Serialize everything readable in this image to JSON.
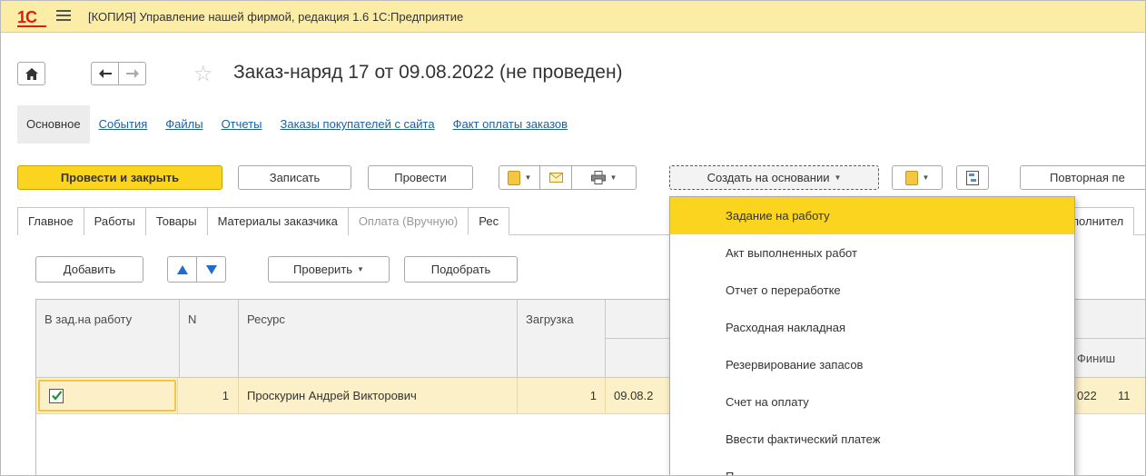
{
  "window": {
    "title": "[КОПИЯ] Управление нашей фирмой, редакция 1.6 1С:Предприятие",
    "logo_text": "1С"
  },
  "document": {
    "title": "Заказ-наряд 17 от 09.08.2022 (не проведен)"
  },
  "sections": [
    {
      "label": "Основное",
      "active": true
    },
    {
      "label": "События"
    },
    {
      "label": "Файлы"
    },
    {
      "label": "Отчеты"
    },
    {
      "label": "Заказы покупателей с сайта"
    },
    {
      "label": "Факт оплаты заказов"
    }
  ],
  "commands": {
    "post_close": "Провести и закрыть",
    "record": "Записать",
    "post": "Провести",
    "create_based": "Создать на основании",
    "repeat": "Повторная пе"
  },
  "form_tabs": [
    {
      "label": "Главное"
    },
    {
      "label": "Работы"
    },
    {
      "label": "Товары"
    },
    {
      "label": "Материалы заказчика"
    },
    {
      "label": "Оплата (Вручную)",
      "disabled": true
    },
    {
      "label": "Рес"
    },
    {
      "label": "полнител"
    }
  ],
  "table_toolbar": {
    "add": "Добавить",
    "check": "Проверить",
    "pick": "Подобрать"
  },
  "table": {
    "headers": {
      "in_task": "В зад.на работу",
      "n": "N",
      "resource": "Ресурс",
      "load": "Загрузка",
      "finish": "Финиш"
    },
    "rows": [
      {
        "checked": true,
        "n": "1",
        "resource": "Проскурин Андрей Викторович",
        "load": "1",
        "start": "09.08.2",
        "finish_date": "022",
        "finish_time": "11"
      }
    ]
  },
  "dropdown_items": [
    {
      "label": "Задание на работу",
      "highlight": true
    },
    {
      "label": "Акт выполненных работ"
    },
    {
      "label": "Отчет о переработке"
    },
    {
      "label": "Расходная накладная"
    },
    {
      "label": "Резервирование запасов"
    },
    {
      "label": "Счет на оплату"
    },
    {
      "label": "Ввести фактический платеж"
    },
    {
      "label": "П"
    }
  ],
  "colors": {
    "titlebar": "#fbeda6",
    "primary_button": "#fbd41f",
    "link": "#1a62a3",
    "selected_row": "#fbf0c8",
    "logo": "#d81f12"
  }
}
